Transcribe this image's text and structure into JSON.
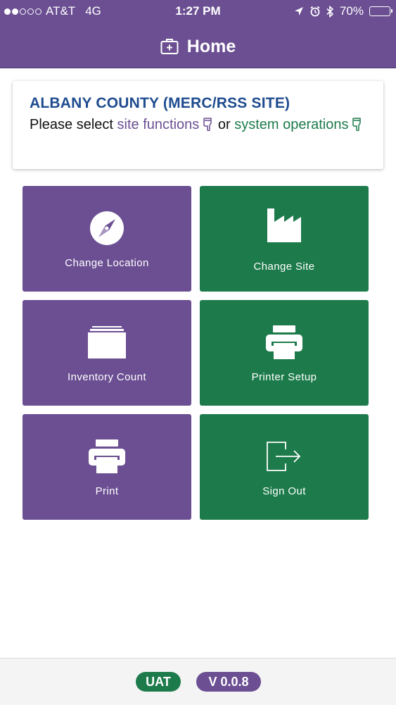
{
  "status_bar": {
    "carrier": "AT&T",
    "network": "4G",
    "time": "1:27 PM",
    "battery": "70%",
    "battery_level": 0.7
  },
  "header": {
    "title": "Home",
    "icon": "first-aid-kit-icon"
  },
  "card": {
    "title": "ALBANY COUNTY (MERC/RSS SITE)",
    "prefix": "Please select",
    "site_functions": "site functions",
    "connector": "or",
    "system_operations": "system operations"
  },
  "tiles": [
    {
      "label": "Change Location",
      "icon": "compass-icon",
      "color": "#6b4f92"
    },
    {
      "label": "Change Site",
      "icon": "factory-icon",
      "color": "#1d7b4b"
    },
    {
      "label": "Inventory Count",
      "icon": "card-stack-icon",
      "color": "#6b4f92"
    },
    {
      "label": "Printer Setup",
      "icon": "printer-icon",
      "color": "#1d7b4b"
    },
    {
      "label": "Print",
      "icon": "printer-icon",
      "color": "#6b4f92"
    },
    {
      "label": "Sign Out",
      "icon": "sign-out-icon",
      "color": "#1d7b4b"
    }
  ],
  "footer": {
    "environment": "UAT",
    "version": "V 0.0.8"
  },
  "colors": {
    "purple": "#6b4f92",
    "green": "#1d7b4b",
    "title_blue": "#1e4b8f"
  }
}
